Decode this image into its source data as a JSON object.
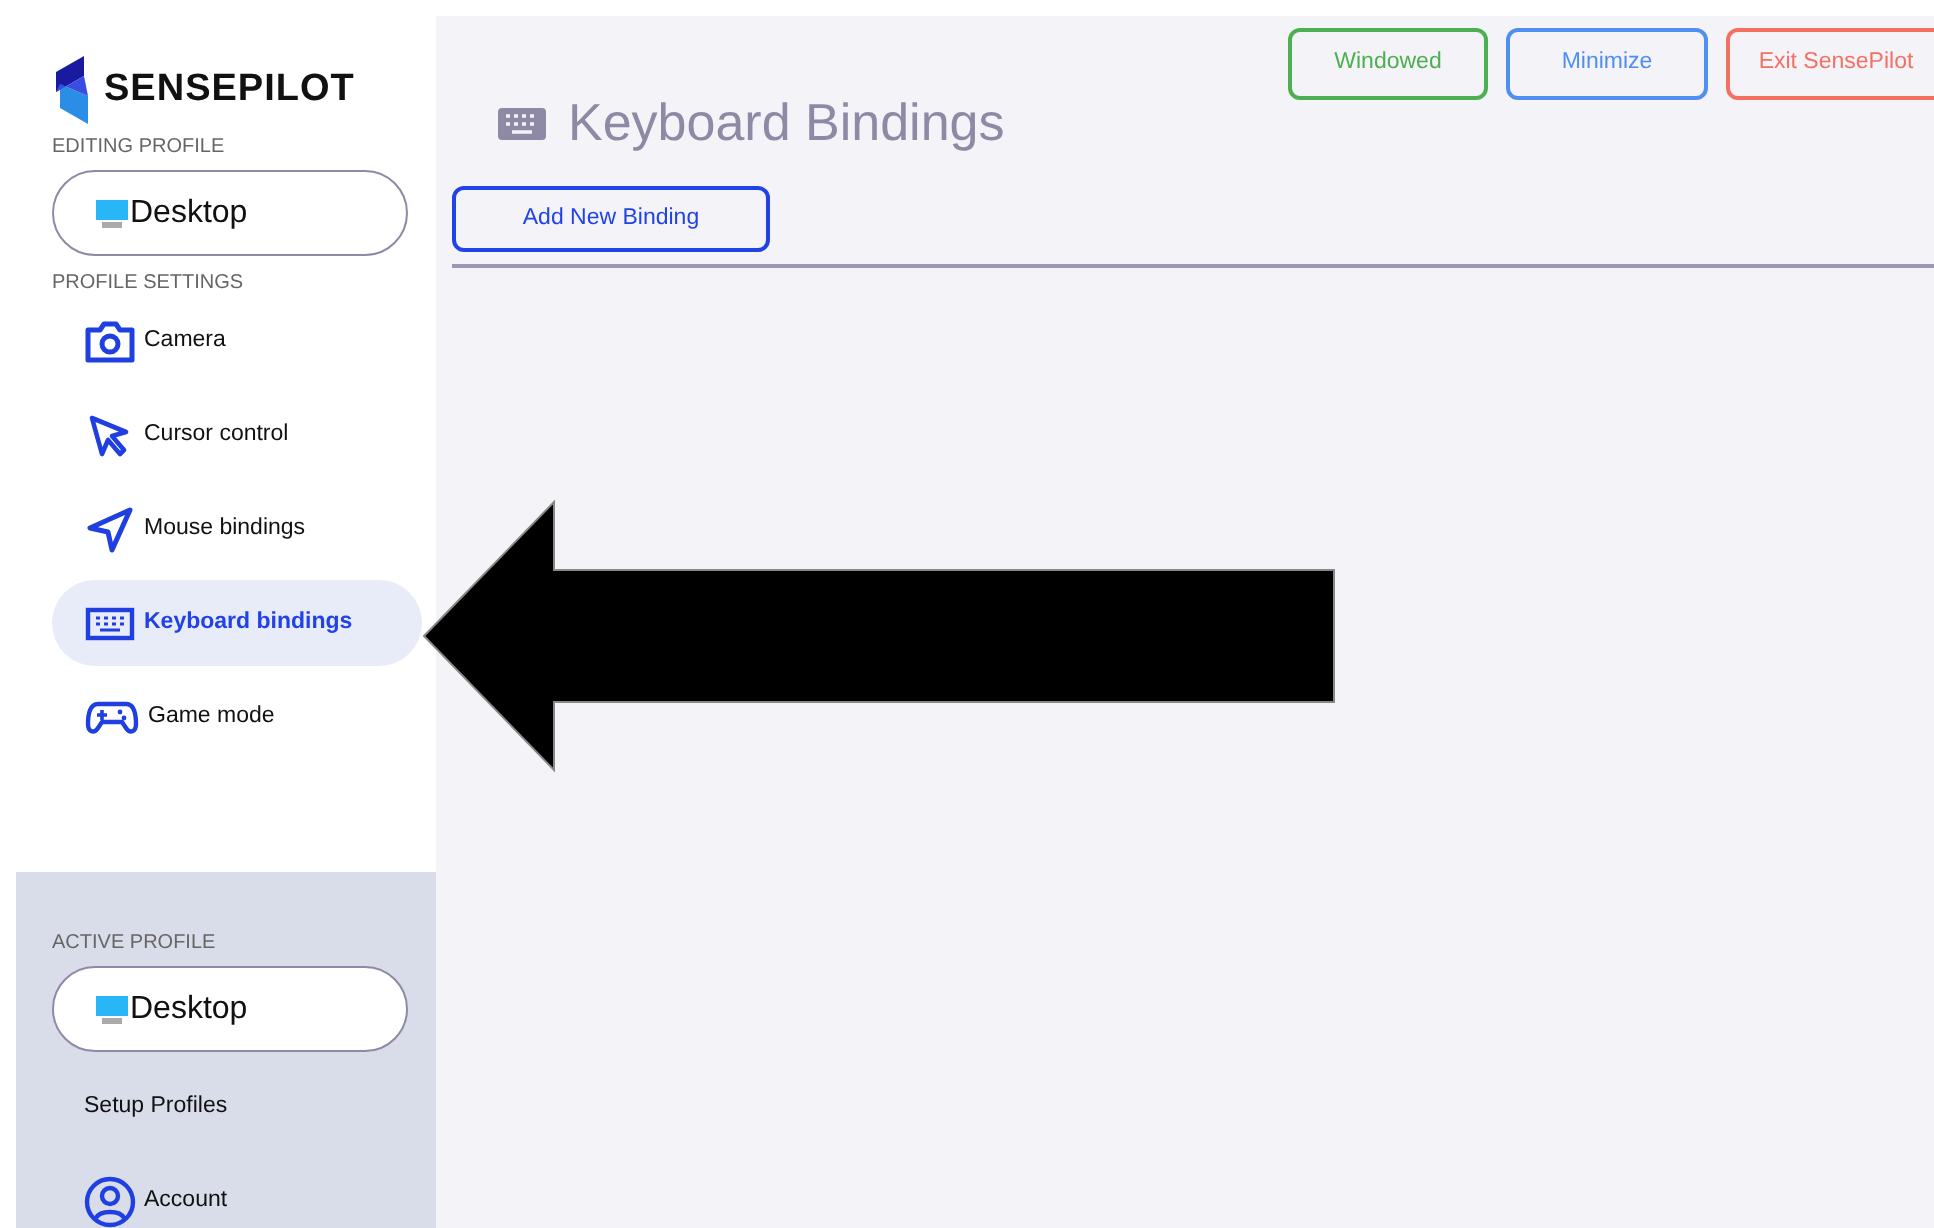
{
  "brand": {
    "name": "SENSEPILOT"
  },
  "editing_profile": {
    "label": "EDITING PROFILE",
    "profile": "Desktop"
  },
  "profile_settings": {
    "label": "PROFILE SETTINGS",
    "items": [
      {
        "kind": "camera",
        "label": "Camera",
        "selected": false
      },
      {
        "kind": "cursor",
        "label": "Cursor control",
        "selected": false
      },
      {
        "kind": "mouse",
        "label": "Mouse bindings",
        "selected": false
      },
      {
        "kind": "keyboard",
        "label": "Keyboard bindings",
        "selected": true
      },
      {
        "kind": "gamepad",
        "label": "Game mode",
        "selected": false
      }
    ]
  },
  "active_profile": {
    "label": "ACTIVE PROFILE",
    "profile": "Desktop"
  },
  "bottom_items": [
    {
      "kind": "plain",
      "label": "Setup Profiles"
    },
    {
      "kind": "account",
      "label": "Account"
    }
  ],
  "window_buttons": [
    {
      "kind": "success",
      "label": "Windowed"
    },
    {
      "kind": "primary",
      "label": "Minimize"
    },
    {
      "kind": "danger",
      "label": "Exit SensePilot"
    }
  ],
  "page": {
    "title": "Keyboard Bindings",
    "add_button": "Add New Binding"
  },
  "annotation": {
    "kind": "arrow-left"
  }
}
